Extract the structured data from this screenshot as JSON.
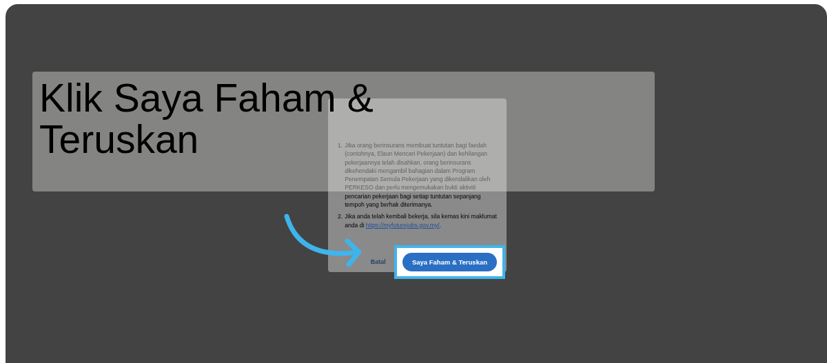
{
  "caption": "Klik Saya Faham & Teruskan",
  "modal": {
    "items": [
      {
        "number": "1.",
        "text": "Jika orang berinsurans membuat tuntutan bagi faedah (contohnya, Elaun Mencari Pekerjaan) dan kehilangan pekerjaannya telah disahkan, orang berinsurans dikehendaki mengambil bahagian dalam Program Penempatan Semula Pekerjaan yang dikendalikan oleh PERKESO dan perlu mengemukakan bukti aktiviti pencarian pekerjaan bagi setiap tuntutan sepanjang tempoh yang berhak diterimanya."
      },
      {
        "number": "2.",
        "text": "Jika anda telah kembali bekerja, sila kemas kini maklumat anda di ",
        "link": "https://myfuturejobs.gov.my/",
        "after": "."
      }
    ],
    "cancel_button": "Batal",
    "confirm_button": {
      "label": "Saya Faham & Teruskan",
      "highlighted": true
    }
  }
}
